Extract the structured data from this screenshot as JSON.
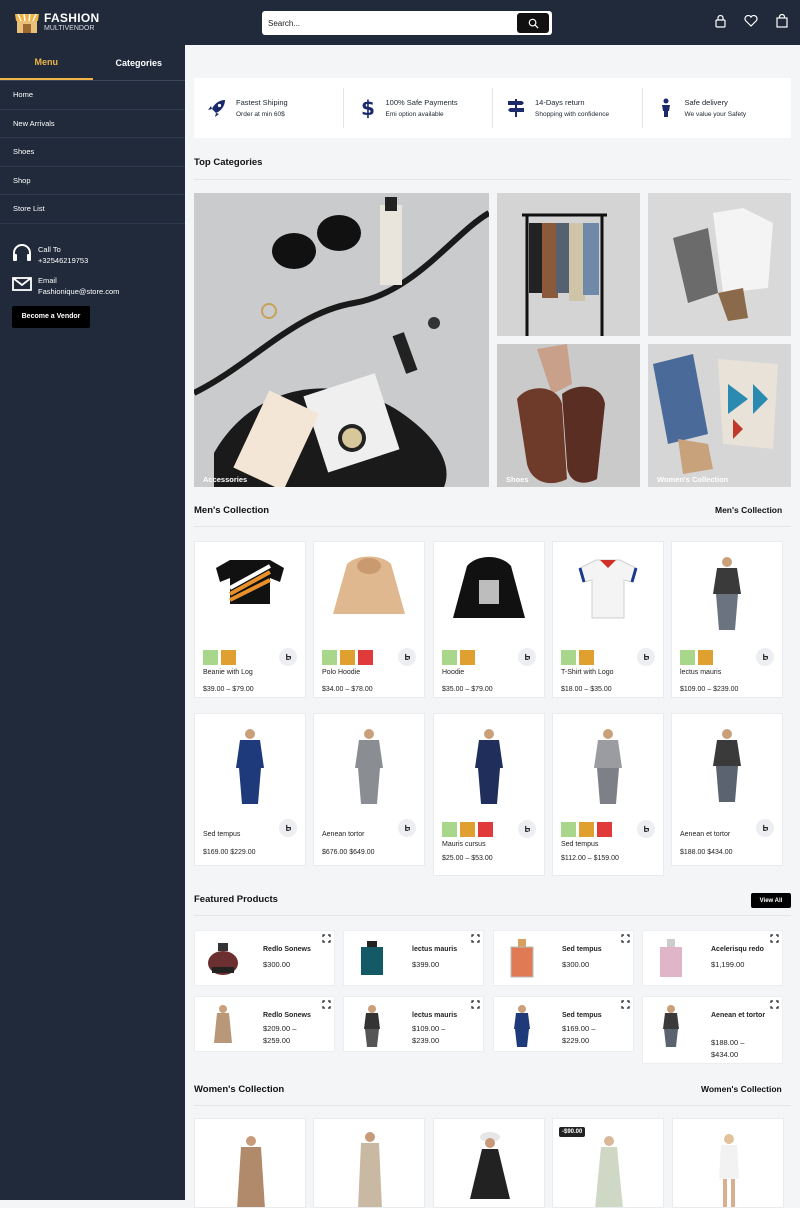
{
  "brand": {
    "name": "FASHION",
    "sub": "MULTIVENDOR"
  },
  "search": {
    "placeholder": "Search..."
  },
  "sidebar": {
    "tabs": [
      {
        "label": "Menu"
      },
      {
        "label": "Categories"
      }
    ],
    "items": [
      {
        "label": "Home"
      },
      {
        "label": "New Arrivals"
      },
      {
        "label": "Shoes"
      },
      {
        "label": "Shop"
      },
      {
        "label": "Store List"
      }
    ],
    "call_label": "Call To",
    "call_number": "+32546219753",
    "email_label": "Email",
    "email_value": "Fashionique@store.com",
    "vendor_button": "Become a Vendor"
  },
  "features": [
    {
      "title": "Fastest Shiping",
      "sub": "Order at min 60$",
      "icon": "rocket-icon"
    },
    {
      "title": "100% Safe Payments",
      "sub": "Emi option available",
      "icon": "dollar-icon"
    },
    {
      "title": "14-Days return",
      "sub": "Shopping with confidence",
      "icon": "signpost-icon"
    },
    {
      "title": "Safe delivery",
      "sub": "We value your Safety",
      "icon": "person-icon"
    }
  ],
  "top_categories": {
    "title": "Top Categories",
    "items": [
      {
        "label": "Accessories"
      },
      {
        "label": ""
      },
      {
        "label": ""
      },
      {
        "label": "Shoes"
      },
      {
        "label": "Women's Collection"
      }
    ]
  },
  "mens": {
    "title": "Men's Collection",
    "link": "Men's Collection",
    "products": [
      {
        "name": "Beanie with Log",
        "price": "$39.00 – $79.00",
        "swatches": [
          "#a8d68a",
          "#e0a030"
        ]
      },
      {
        "name": "Polo Hoodie",
        "price": "$34.00 – $78.00",
        "swatches": [
          "#a8d68a",
          "#e0a030",
          "#e03a3a"
        ]
      },
      {
        "name": "Hoodie",
        "price": "$35.00 – $79.00",
        "swatches": [
          "#a8d68a",
          "#e0a030"
        ]
      },
      {
        "name": "T-Shirt with Logo",
        "price": "$18.00 – $35.00",
        "swatches": [
          "#a8d68a",
          "#e0a030"
        ]
      },
      {
        "name": "lectus mauris",
        "price": "$109.00 – $239.00",
        "swatches": [
          "#a8d68a",
          "#e0a030"
        ]
      },
      {
        "name": "Sed tempus",
        "price": "$169.00 $229.00",
        "swatches": []
      },
      {
        "name": "Aenean tortor",
        "price": "$676.00 $649.00",
        "swatches": []
      },
      {
        "name": "Mauris cursus",
        "price": "$25.00 – $53.00",
        "swatches": [
          "#a8d68a",
          "#e0a030",
          "#e03a3a"
        ]
      },
      {
        "name": "Sed tempus",
        "price": "$112.00 – $159.00",
        "swatches": [
          "#a8d68a",
          "#e0a030",
          "#e03a3a"
        ]
      },
      {
        "name": "Aenean et tortor",
        "price": "$188.00 $434.00",
        "swatches": []
      }
    ]
  },
  "featured": {
    "title": "Featured Products",
    "view_all": "View All",
    "items": [
      {
        "name": "Redlo Sonews",
        "price": "$300.00"
      },
      {
        "name": "lectus mauris",
        "price": "$399.00"
      },
      {
        "name": "Sed tempus",
        "price": "$300.00"
      },
      {
        "name": "Acelerisqu redo",
        "price": "$1,199.00"
      },
      {
        "name": "Redlo Sonews",
        "price": "$209.00 – $259.00"
      },
      {
        "name": "lectus mauris",
        "price": "$109.00 – $239.00"
      },
      {
        "name": "Sed tempus",
        "price": "$169.00 – $229.00"
      },
      {
        "name": "Aenean et tortor",
        "price": "$188.00 – $434.00"
      }
    ]
  },
  "womens": {
    "title": "Women's Collection",
    "link": "Women's Collection",
    "sale_badge": "-$90.00"
  },
  "colors": {
    "nav": "#202a3a",
    "accent": "#f0b445",
    "swatch_green": "#a8d68a",
    "swatch_orange": "#e0a030",
    "swatch_red": "#e03a3a"
  }
}
